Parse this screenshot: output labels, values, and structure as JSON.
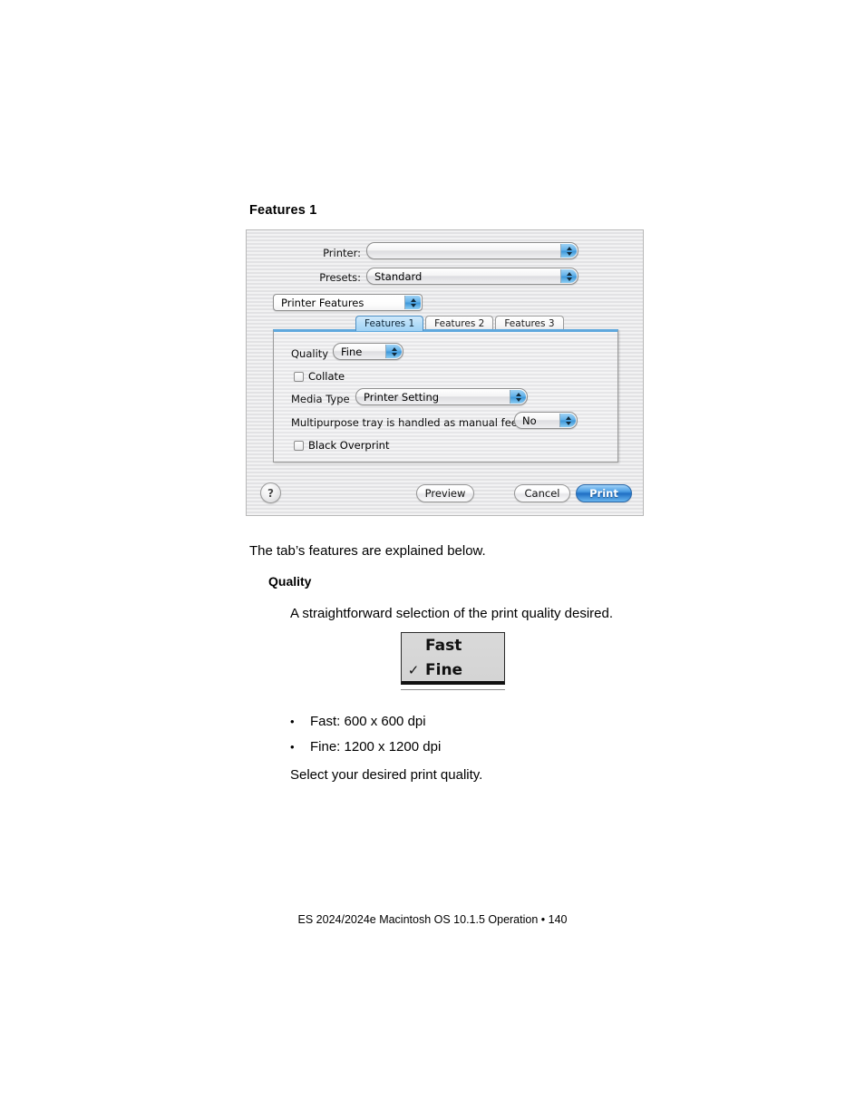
{
  "document": {
    "heading": "Features 1",
    "intro_paragraph": "The tab’s features are explained below.",
    "sub_heading": "Quality",
    "quality_paragraph": "A straightforward selection of the print quality desired.",
    "bullets": [
      {
        "marker": "•",
        "text": "Fast: 600 x 600 dpi"
      },
      {
        "marker": "•",
        "text": "Fine: 1200 x 1200 dpi"
      }
    ],
    "closing_paragraph": "Select your desired print quality.",
    "footer": "ES 2024/2024e Macintosh OS 10.1.5 Operation • 140"
  },
  "print_dialog": {
    "printer_label": "Printer:",
    "printer_value": "",
    "presets_label": "Presets:",
    "presets_value": "Standard",
    "pane_popup_value": "Printer Features",
    "tabs": [
      {
        "label": "Features 1",
        "active": true
      },
      {
        "label": "Features 2",
        "active": false
      },
      {
        "label": "Features 3",
        "active": false
      }
    ],
    "panel": {
      "quality_label": "Quality",
      "quality_value": "Fine",
      "collate_label": "Collate",
      "collate_checked": false,
      "media_type_label": "Media Type",
      "media_type_value": "Printer Setting",
      "manual_feed_label": "Multipurpose tray is handled as manual feed",
      "manual_feed_value": "No",
      "black_overprint_label": "Black Overprint",
      "black_overprint_checked": false
    },
    "buttons": {
      "help_label": "?",
      "preview_label": "Preview",
      "cancel_label": "Cancel",
      "print_label": "Print"
    },
    "accent_color": "#3e98da",
    "default_button_color": "#1f6fc4"
  },
  "quality_menu": {
    "items": [
      {
        "check": "",
        "label": "Fast"
      },
      {
        "check": "✓",
        "label": "Fine"
      }
    ]
  }
}
